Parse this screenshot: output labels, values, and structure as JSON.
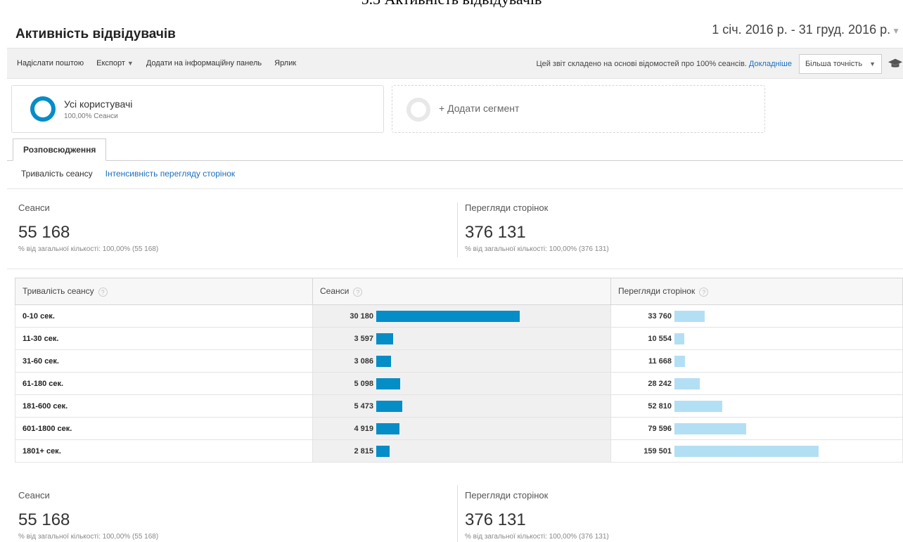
{
  "doc_caption": "5.3 Активність відвідувачів",
  "header": {
    "title": "Активність відвідувачів",
    "date_range": "1 січ. 2016 р. - 31 груд. 2016 р."
  },
  "toolbar": {
    "email": "Надіслати поштою",
    "export": "Експорт",
    "add_dashboard": "Додати на інформаційну панель",
    "shortcut": "Ярлик",
    "sampling_text": "Цей звіт складено на основі відомостей про 100% сеансів.",
    "learn_more": "Докладніше",
    "precision": "Більша точність"
  },
  "segments": {
    "active_name": "Усі користувачі",
    "active_sub": "100,00% Сеанси",
    "add_label": "+ Додати сегмент"
  },
  "tabs": {
    "distribution": "Розповсюдження"
  },
  "subtabs": {
    "session_duration": "Тривалість сеансу",
    "page_depth": "Інтенсивність перегляду сторінок"
  },
  "summary": {
    "sessions_label": "Сеанси",
    "sessions_value": "55 168",
    "sessions_sub": "% від загальної кількості: 100,00% (55 168)",
    "pageviews_label": "Перегляди сторінок",
    "pageviews_value": "376 131",
    "pageviews_sub": "% від загальної кількості: 100,00% (376 131)"
  },
  "table": {
    "headers": [
      "Тривалість сеансу",
      "Сеанси",
      "Перегляди сторінок"
    ],
    "rows": [
      {
        "label": "0-10 сек.",
        "sessions": "30 180",
        "pageviews": "33 760"
      },
      {
        "label": "11-30 сек.",
        "sessions": "3 597",
        "pageviews": "10 554"
      },
      {
        "label": "31-60 сек.",
        "sessions": "3 086",
        "pageviews": "11 668"
      },
      {
        "label": "61-180 сек.",
        "sessions": "5 098",
        "pageviews": "28 242"
      },
      {
        "label": "181-600 сек.",
        "sessions": "5 473",
        "pageviews": "52 810"
      },
      {
        "label": "601-1800 сек.",
        "sessions": "4 919",
        "pageviews": "79 596"
      },
      {
        "label": "1801+ сек.",
        "sessions": "2 815",
        "pageviews": "159 501"
      }
    ]
  },
  "colors": {
    "sessions_bar": "#058dc7",
    "pageviews_bar": "#b3dff4",
    "link": "#1a6fbd"
  },
  "icons": {
    "graduation": "graduation-cap-icon"
  }
}
